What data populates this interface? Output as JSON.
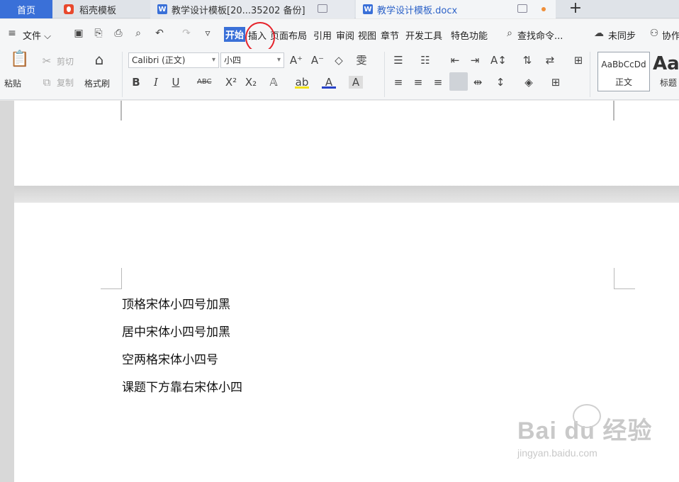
{
  "tabs": {
    "home": "首页",
    "t1": "稻壳模板",
    "t2": "教学设计模板[20...35202 备份]",
    "t3": "教学设计模板.docx",
    "doc_icon_letter": "W"
  },
  "menu": {
    "file": "文件",
    "items": [
      "开始",
      "插入",
      "页面布局",
      "引用",
      "审阅",
      "视图",
      "章节",
      "开发工具",
      "特色功能"
    ],
    "search": "查找命令...",
    "sync": "未同步",
    "collab": "协作"
  },
  "ribbon": {
    "paste": "粘贴",
    "cut": "剪切",
    "copy": "复制",
    "format_painter": "格式刷",
    "font_name": "Calibri (正文)",
    "font_size": "小四",
    "style_normal_sample": "AaBbCcDd",
    "style_normal": "正文",
    "style_heading_sample": "Aa",
    "style_heading": "标题"
  },
  "document": {
    "lines": [
      "顶格宋体小四号加黑",
      "居中宋体小四号加黑",
      "空两格宋体小四号",
      "课题下方靠右宋体小四"
    ]
  },
  "watermark": {
    "brand": "Bai du 经验",
    "url": "jingyan.baidu.com"
  },
  "colors": {
    "accent": "#3a70d8",
    "highlight_circle": "#e5232b"
  }
}
